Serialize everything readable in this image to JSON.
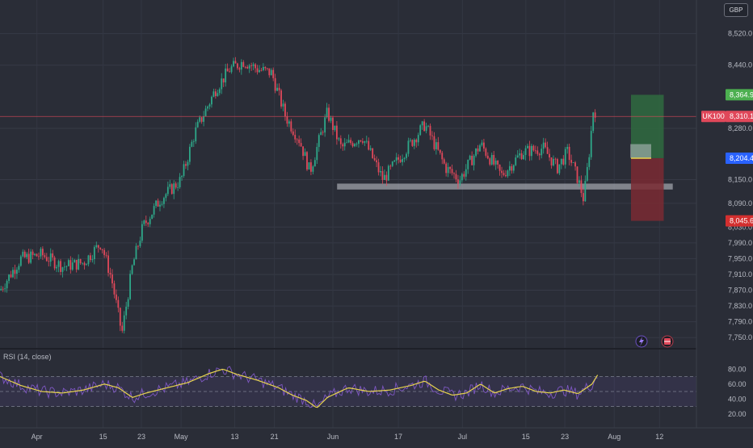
{
  "currency": "GBP",
  "instrument_tag": "UK100",
  "rsi_title": "RSI (14, close)",
  "icons": [
    "lightning-icon",
    "event-flag-icon"
  ],
  "colors": {
    "background": "#2a2d37",
    "up": "#2ea889",
    "down": "#e0485a",
    "price_line": "#e0485a",
    "rsi_line": "#7e57c2",
    "rsi_ma": "#e8d44d",
    "profit_zone": "#2f6b3f",
    "loss_zone": "#7a2a33",
    "entry_tag": "#2962ff"
  },
  "chart_data": [
    {
      "type": "candlestick",
      "title": "",
      "ylim": [
        7730,
        8560
      ],
      "y_ticks": [
        "8,520.0",
        "8,440.0",
        "8,280.0",
        "8,150.0",
        "8,090.0",
        "8,030.0",
        "7,990.0",
        "7,950.0",
        "7,910.0",
        "7,870.0",
        "7,830.0",
        "7,790.0",
        "7,750.0"
      ],
      "y_tick_values": [
        8520,
        8440,
        8280,
        8150,
        8090,
        8030,
        7990,
        7950,
        7910,
        7870,
        7830,
        7790,
        7750
      ],
      "x_ticks": [
        "Apr",
        "15",
        "23",
        "May",
        "13",
        "21",
        "Jun",
        "17",
        "Jul",
        "15",
        "23",
        "Aug",
        "12"
      ],
      "x_tick_positions": [
        0.053,
        0.148,
        0.203,
        0.26,
        0.337,
        0.394,
        0.478,
        0.572,
        0.664,
        0.755,
        0.811,
        0.882,
        0.947
      ],
      "key_path": [
        [
          0.0,
          7870
        ],
        [
          0.03,
          7950
        ],
        [
          0.06,
          7960
        ],
        [
          0.09,
          7930
        ],
        [
          0.12,
          7940
        ],
        [
          0.145,
          7990
        ],
        [
          0.16,
          7900
        ],
        [
          0.175,
          7760
        ],
        [
          0.19,
          7930
        ],
        [
          0.205,
          8030
        ],
        [
          0.23,
          8100
        ],
        [
          0.26,
          8150
        ],
        [
          0.28,
          8270
        ],
        [
          0.31,
          8380
        ],
        [
          0.33,
          8430
        ],
        [
          0.35,
          8450
        ],
        [
          0.37,
          8430
        ],
        [
          0.39,
          8420
        ],
        [
          0.41,
          8310
        ],
        [
          0.43,
          8250
        ],
        [
          0.445,
          8170
        ],
        [
          0.47,
          8320
        ],
        [
          0.49,
          8230
        ],
        [
          0.52,
          8260
        ],
        [
          0.55,
          8150
        ],
        [
          0.58,
          8220
        ],
        [
          0.61,
          8290
        ],
        [
          0.64,
          8180
        ],
        [
          0.66,
          8150
        ],
        [
          0.69,
          8240
        ],
        [
          0.72,
          8160
        ],
        [
          0.75,
          8220
        ],
        [
          0.78,
          8230
        ],
        [
          0.8,
          8180
        ],
        [
          0.815,
          8220
        ],
        [
          0.83,
          8150
        ],
        [
          0.838,
          8100
        ],
        [
          0.845,
          8200
        ],
        [
          0.852,
          8330
        ],
        [
          0.856,
          8320
        ]
      ],
      "support_zone": [
        8125,
        8140
      ],
      "current_price": {
        "label": "8,310.1",
        "value": 8310.1
      },
      "position": {
        "target": {
          "label": "8,364.9",
          "value": 8364.9
        },
        "entry": {
          "label": "8,204.4",
          "value": 8204.4
        },
        "stop": {
          "label": "8,045.6",
          "value": 8045.6
        }
      }
    },
    {
      "type": "line",
      "title": "RSI (14, close)",
      "ylim": [
        10,
        90
      ],
      "y_ticks": [
        "80.00",
        "60.00",
        "40.00",
        "20.00"
      ],
      "y_tick_values": [
        80,
        60,
        40,
        20
      ],
      "levels": [
        70,
        50,
        30
      ],
      "key_path": [
        [
          0.0,
          70
        ],
        [
          0.03,
          58
        ],
        [
          0.06,
          50
        ],
        [
          0.09,
          48
        ],
        [
          0.12,
          52
        ],
        [
          0.15,
          60
        ],
        [
          0.17,
          55
        ],
        [
          0.19,
          42
        ],
        [
          0.21,
          48
        ],
        [
          0.24,
          55
        ],
        [
          0.27,
          62
        ],
        [
          0.3,
          74
        ],
        [
          0.32,
          80
        ],
        [
          0.34,
          73
        ],
        [
          0.37,
          65
        ],
        [
          0.4,
          55
        ],
        [
          0.42,
          45
        ],
        [
          0.44,
          38
        ],
        [
          0.455,
          28
        ],
        [
          0.47,
          42
        ],
        [
          0.5,
          55
        ],
        [
          0.53,
          50
        ],
        [
          0.56,
          52
        ],
        [
          0.59,
          58
        ],
        [
          0.61,
          64
        ],
        [
          0.63,
          52
        ],
        [
          0.65,
          45
        ],
        [
          0.67,
          48
        ],
        [
          0.69,
          60
        ],
        [
          0.71,
          48
        ],
        [
          0.73,
          54
        ],
        [
          0.75,
          57
        ],
        [
          0.77,
          50
        ],
        [
          0.79,
          48
        ],
        [
          0.81,
          52
        ],
        [
          0.83,
          47
        ],
        [
          0.85,
          60
        ],
        [
          0.858,
          72
        ]
      ]
    }
  ]
}
